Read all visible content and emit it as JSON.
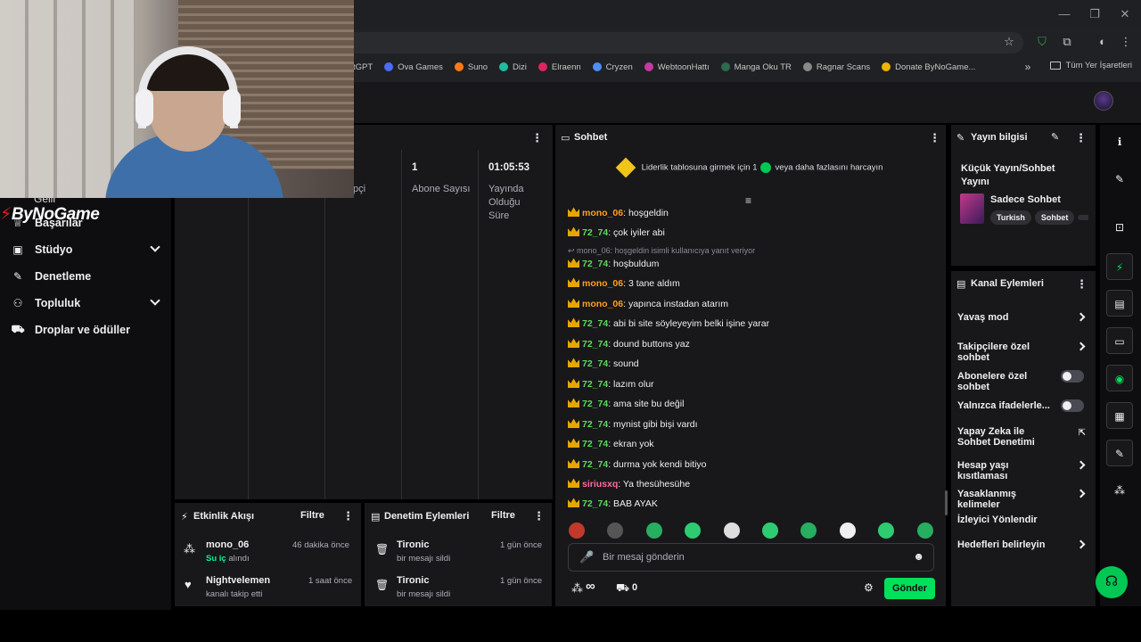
{
  "browser": {
    "window_controls": [
      "—",
      "❐",
      "✕"
    ],
    "bookmarks": [
      {
        "label": "tGPT",
        "color": ""
      },
      {
        "label": "Ova Games",
        "color": "#4a6cf7"
      },
      {
        "label": "Suno",
        "color": "#ff7a1a"
      },
      {
        "label": "Dizi",
        "color": "#22bba0"
      },
      {
        "label": "Elraenn",
        "color": "#e0245e"
      },
      {
        "label": "Cryzen",
        "color": "#4f8ef7"
      },
      {
        "label": "WebtoonHattı",
        "color": "#c43aa0"
      },
      {
        "label": "Manga Oku TR",
        "color": "#2d6a4f"
      },
      {
        "label": "Ragnar Scans",
        "color": "#888888"
      },
      {
        "label": "Donate ByNoGame...",
        "color": "#f0b400"
      }
    ],
    "bookmarks_more": "»",
    "all_bookmarks": "Tüm Yer İşaretleri"
  },
  "leftnav": {
    "logo": "ByNoGame",
    "partial_top": "Gelir",
    "items": [
      {
        "label": "Başarılar",
        "icon": "trophy-icon",
        "glyph": "♕",
        "chevron": false
      },
      {
        "label": "Stüdyo",
        "icon": "studio-icon",
        "glyph": "▣",
        "chevron": true
      },
      {
        "label": "Denetleme",
        "icon": "wrench-icon",
        "glyph": "✎",
        "chevron": false
      },
      {
        "label": "Topluluk",
        "icon": "community-icon",
        "glyph": "⚇",
        "chevron": true
      },
      {
        "label": "Droplar ve ödüller",
        "icon": "drops-icon",
        "glyph": "⛟",
        "chevron": false
      }
    ]
  },
  "stats": {
    "columns": [
      {
        "value": "",
        "label": "pçi"
      },
      {
        "value": "1",
        "label": "Abone Sayısı"
      },
      {
        "value": "01:05:53",
        "label": "Yayında Olduğu Süre"
      }
    ]
  },
  "activity": {
    "title": "Etkinlik Akışı",
    "filter": "Filtre",
    "items": [
      {
        "name": "mono_06",
        "time": "46 dakika önce",
        "highlight": "Su iç",
        "sub": " alındı"
      },
      {
        "name": "Nightvelemen",
        "time": "1 saat önce",
        "highlight": "",
        "sub": "kanalı takip etti"
      }
    ]
  },
  "moderation": {
    "title": "Denetim Eylemleri",
    "filter": "Filtre",
    "items": [
      {
        "name": "Tironic",
        "time": "1 gün önce",
        "sub": "bir mesajı sildi"
      },
      {
        "name": "Tironic",
        "time": "1 gün önce",
        "sub": "bir mesajı sildi"
      }
    ]
  },
  "chat": {
    "title": "Sohbet",
    "leaderboard_pre": "Liderlik tablosuna girmek için 1",
    "leaderboard_post": "veya daha fazlasını harcayın",
    "reply_note": "mono_06: hoşgeldin isimli kullanıcıya yanıt veriyor",
    "messages": [
      {
        "user": "mono_06",
        "cls": "u1",
        "text": ": hoşgeldin"
      },
      {
        "user": "72_74",
        "cls": "u2",
        "text": ": çok iyiler abi"
      },
      {
        "user": "72_74",
        "cls": "u2",
        "text": ": hoşbuldum"
      },
      {
        "user": "mono_06",
        "cls": "u1",
        "text": ": 3 tane aldım"
      },
      {
        "user": "mono_06",
        "cls": "u1",
        "text": ": yapınca instadan atarım"
      },
      {
        "user": "72_74",
        "cls": "u2",
        "text": ": abi bi site söyleyeyim belki işine yarar"
      },
      {
        "user": "72_74",
        "cls": "u2",
        "text": ": dound buttons yaz"
      },
      {
        "user": "72_74",
        "cls": "u2",
        "text": ": sound"
      },
      {
        "user": "72_74",
        "cls": "u2",
        "text": ": lazım olur"
      },
      {
        "user": "72_74",
        "cls": "u2",
        "text": ": ama site bu değil"
      },
      {
        "user": "72_74",
        "cls": "u2",
        "text": ": mynist gibi bişi vardı"
      },
      {
        "user": "72_74",
        "cls": "u2",
        "text": ": ekran yok"
      },
      {
        "user": "72_74",
        "cls": "u2",
        "text": ": durma yok kendi bitiyo"
      },
      {
        "user": "siriusxq",
        "cls": "u3",
        "text": ": Ya thesühesühe"
      },
      {
        "user": "72_74",
        "cls": "u2",
        "text": ": BAB AYAK"
      }
    ],
    "emotes": [
      "#c0392b",
      "#555555",
      "#27ae60",
      "#2ecc71",
      "#dddddd",
      "#2ecc71",
      "#27ae60",
      "#eeeeee",
      "#2ecc71",
      "#27ae60",
      "#2ecc71"
    ],
    "placeholder": "Bir mesaj gönderin",
    "points_symbol": "∞",
    "drops_count": "0",
    "send_label": "Gönder"
  },
  "stream_info": {
    "title": "Yayın bilgisi",
    "stream_title": "Küçük Yayın/Sohbet Yayını",
    "category": "Sadece Sohbet",
    "tags": [
      "Turkish",
      "Sohbet"
    ]
  },
  "channel_actions": {
    "title": "Kanal Eylemleri",
    "items": [
      {
        "label": "Yavaş mod",
        "control": "arrow"
      },
      {
        "label": "Takipçilere özel sohbet",
        "control": "arrow"
      },
      {
        "label": "Abonelere özel sohbet",
        "control": "toggle"
      },
      {
        "label": "Yalnızca ifadelerle...",
        "control": "toggle"
      },
      {
        "label": "Yapay Zeka ile Sohbet Denetimi",
        "control": "external"
      },
      {
        "label": "Hesap yaşı kısıtlaması",
        "control": "arrow"
      },
      {
        "label": "Yasaklanmış kelimeler",
        "control": "arrow"
      },
      {
        "label": "İzleyici Yönlendir",
        "control": "none"
      },
      {
        "label": "Hedefleri belirleyin",
        "control": "arrow"
      }
    ]
  },
  "rail": {
    "buttons": [
      {
        "icon": "info-icon",
        "glyph": "ℹ"
      },
      {
        "icon": "pencil-icon",
        "glyph": "✎"
      },
      {
        "icon": "capture-icon",
        "glyph": "⊡"
      },
      {
        "icon": "bolt-icon",
        "glyph": "⚡"
      },
      {
        "icon": "notes-icon",
        "glyph": "▤"
      },
      {
        "icon": "chat-bubble-icon",
        "glyph": "▭"
      },
      {
        "icon": "broadcast-icon",
        "glyph": "◉"
      },
      {
        "icon": "layout-icon",
        "glyph": "▦"
      },
      {
        "icon": "wrench-icon",
        "glyph": "✎"
      },
      {
        "icon": "community-icon",
        "glyph": "⁂"
      }
    ],
    "fab_glyph": "☊"
  }
}
